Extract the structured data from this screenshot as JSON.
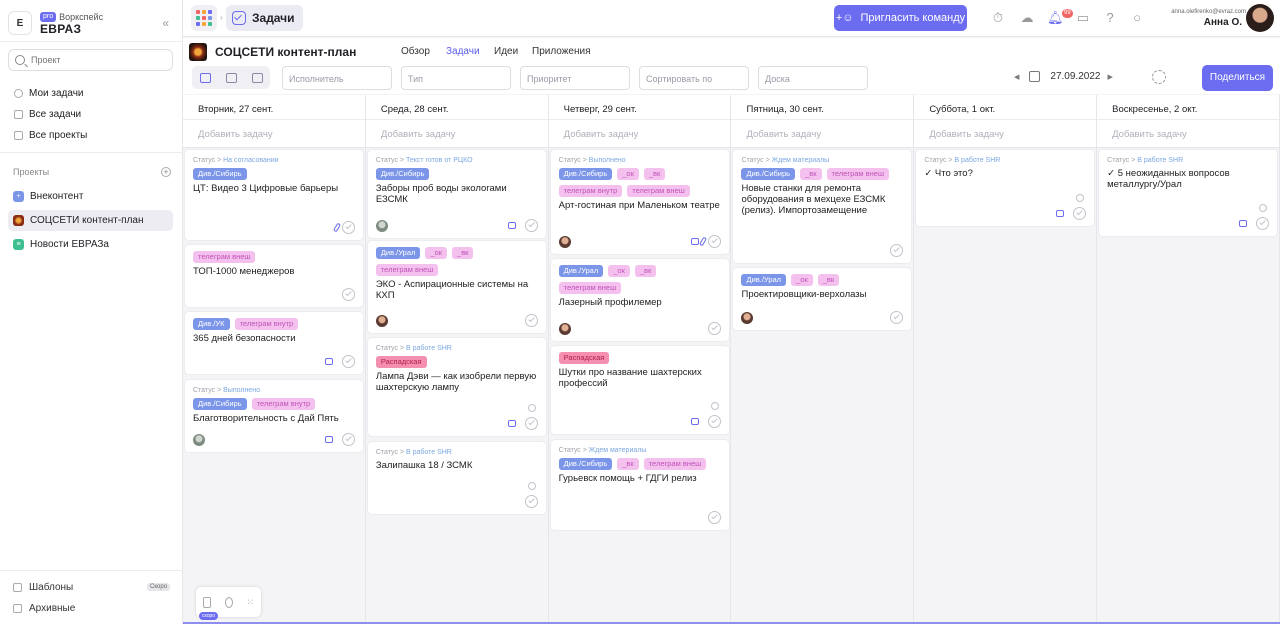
{
  "workspace": {
    "logo_letter": "E",
    "pro_badge": "pro",
    "label": "Воркспейс",
    "name": "ЕВРАЗ"
  },
  "search": {
    "placeholder": "Проект"
  },
  "nav": [
    {
      "label": "Мои задачи"
    },
    {
      "label": "Все задачи"
    },
    {
      "label": "Все проекты"
    }
  ],
  "projects_header": "Проекты",
  "projects": [
    {
      "label": "Внеконтент",
      "color": "#7b95e8"
    },
    {
      "label": "СОЦСЕТИ контент-план",
      "color": "#8a2c14"
    },
    {
      "label": "Новости ЕВРАЗа",
      "color": "#3fbf8f"
    }
  ],
  "bottom_nav": [
    {
      "label": "Шаблоны",
      "badge": "Скоро"
    },
    {
      "label": "Архивные"
    }
  ],
  "topbar": {
    "section": "Задачи",
    "invite_label": "Пригласить команду",
    "notifications_count": "99",
    "user_email": "anna.olefirenko@evraz.com",
    "user_name": "Анна О."
  },
  "project": {
    "title": "СОЦСЕТИ контент-план",
    "tabs": [
      "Обзор",
      "Задачи",
      "Идеи",
      "Приложения"
    ],
    "active_tab": "Задачи",
    "filters": [
      "Исполнитель",
      "Тип",
      "Приоритет",
      "Сортировать по",
      "Доска"
    ],
    "date": "27.09.2022",
    "share_label": "Поделиться"
  },
  "add_task_label": "Добавить задачу",
  "status_label": "Статус",
  "columns": [
    {
      "day": "Вторник, 27 сент.",
      "cards": [
        {
          "status": "На согласовании",
          "tags": [
            {
              "t": "Див./Сибирь",
              "c": "blue"
            }
          ],
          "title": "ЦТ: Видео 3 Цифровые барьеры"
        },
        {
          "status": "",
          "tags": [
            {
              "t": "телеграм внеш",
              "c": "pink"
            }
          ],
          "title": "ТОП-1000 менеджеров"
        },
        {
          "status": "",
          "tags": [
            {
              "t": "Див./УК",
              "c": "blue"
            },
            {
              "t": "телеграм внутр",
              "c": "pink"
            }
          ],
          "title": "365 дней безопасности"
        },
        {
          "status": "Выполнено",
          "tags": [
            {
              "t": "Див./Сибирь",
              "c": "blue"
            },
            {
              "t": "телеграм внутр",
              "c": "pink"
            }
          ],
          "title": "Благотворительность с Дай Пять"
        }
      ]
    },
    {
      "day": "Среда, 28 сент.",
      "cards": [
        {
          "status": "Текст готов от РЦКО",
          "tags": [
            {
              "t": "Див./Сибирь",
              "c": "blue"
            }
          ],
          "title": "Заборы проб воды экологами ЕЗСМК"
        },
        {
          "status": "",
          "tags": [
            {
              "t": "Див./Урал",
              "c": "blue"
            },
            {
              "t": "_ок",
              "c": "pink"
            },
            {
              "t": "_вк",
              "c": "pink"
            },
            {
              "t": "телеграм внеш",
              "c": "pink"
            }
          ],
          "title": "ЭКО - Аспирационные системы на КХП"
        },
        {
          "status": "В работе SHR",
          "tags": [
            {
              "t": "Распадская",
              "c": "red"
            }
          ],
          "title": "Лампа Дэви — как изобрели первую шахтерскую лампу"
        },
        {
          "status": "В работе SHR",
          "tags": [],
          "title": "Залипашка 18 / ЗСМК"
        }
      ]
    },
    {
      "day": "Четверг, 29 сент.",
      "cards": [
        {
          "status": "Выполнено",
          "tags": [
            {
              "t": "Див./Сибирь",
              "c": "blue"
            },
            {
              "t": "_ок",
              "c": "pink"
            },
            {
              "t": "_вк",
              "c": "pink"
            },
            {
              "t": "телеграм внутр",
              "c": "pink"
            },
            {
              "t": "телеграм внеш",
              "c": "pink"
            }
          ],
          "title": "Арт-гостиная при Маленьком театре"
        },
        {
          "status": "",
          "tags": [
            {
              "t": "Див./Урал",
              "c": "blue"
            },
            {
              "t": "_ок",
              "c": "pink"
            },
            {
              "t": "_вк",
              "c": "pink"
            },
            {
              "t": "телеграм внеш",
              "c": "pink"
            }
          ],
          "title": "Лазерный профилемер"
        },
        {
          "status": "",
          "tags": [
            {
              "t": "Распадская",
              "c": "red"
            }
          ],
          "title": "Шутки про название шахтерских профессий"
        },
        {
          "status": "Ждем материалы",
          "tags": [
            {
              "t": "Див./Сибирь",
              "c": "blue"
            },
            {
              "t": "_вк",
              "c": "pink"
            },
            {
              "t": "телеграм внеш",
              "c": "pink"
            }
          ],
          "title": "Гурьевск помощь + ГДГИ релиз"
        }
      ]
    },
    {
      "day": "Пятница, 30 сент.",
      "cards": [
        {
          "status": "Ждем материалы",
          "tags": [
            {
              "t": "Див./Сибирь",
              "c": "blue"
            },
            {
              "t": "_вк",
              "c": "pink"
            },
            {
              "t": "телеграм внеш",
              "c": "pink"
            }
          ],
          "title": "Новые станки для ремонта оборудования в мехцехе ЕЗСМК (релиз). Импортозамещение"
        },
        {
          "status": "",
          "tags": [
            {
              "t": "Див./Урал",
              "c": "blue"
            },
            {
              "t": "_ок",
              "c": "pink"
            },
            {
              "t": "_вк",
              "c": "pink"
            }
          ],
          "title": "Проектировщики-верхолазы"
        }
      ]
    },
    {
      "day": "Суббота, 1 окт.",
      "cards": [
        {
          "status": "В работе SHR",
          "tags": [],
          "title": "Что это?"
        }
      ]
    },
    {
      "day": "Воскресенье, 2 окт.",
      "cards": [
        {
          "status": "В работе SHR",
          "tags": [],
          "title": "5 неожиданных вопросов металлургу/Урал"
        }
      ]
    }
  ],
  "mini_tools_badge": "скоро"
}
